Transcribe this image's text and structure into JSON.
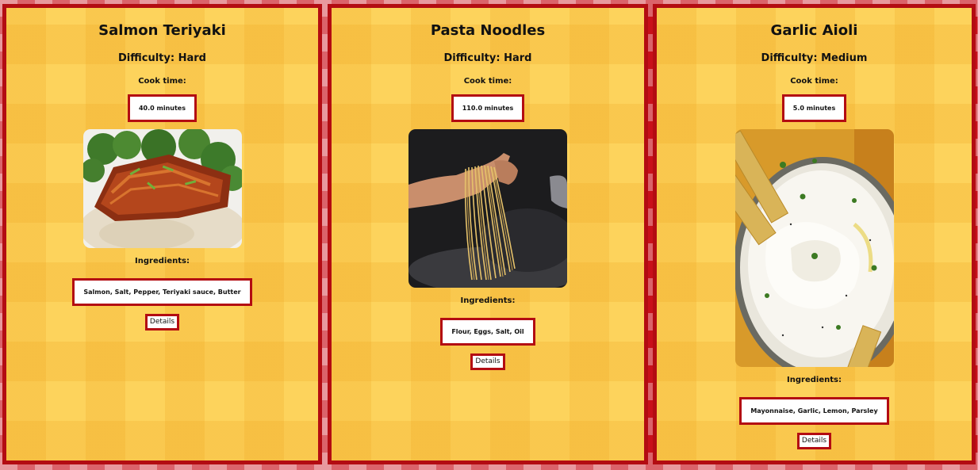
{
  "recipes": [
    {
      "title": "Salmon Teriyaki",
      "difficulty": "Difficulty: Hard",
      "cook_time_label": "Cook time:",
      "cook_time": "40.0 minutes",
      "ingredients_label": "Ingredients:",
      "ingredients": "Salmon, Salt, Pepper, Teriyaki sauce, Butter",
      "details_label": "Details"
    },
    {
      "title": "Pasta Noodles",
      "difficulty": "Difficulty: Hard",
      "cook_time_label": "Cook time:",
      "cook_time": "110.0 minutes",
      "ingredients_label": "Ingredients:",
      "ingredients": "Flour, Eggs, Salt, Oil",
      "details_label": "Details"
    },
    {
      "title": "Garlic Aioli",
      "difficulty": "Difficulty: Medium",
      "cook_time_label": "Cook time:",
      "cook_time": "5.0 minutes",
      "ingredients_label": "Ingredients:",
      "ingredients": "Mayonnaise, Garlic, Lemon, Parsley",
      "details_label": "Details"
    }
  ],
  "colors": {
    "page_background": "#c8101a",
    "card_background": "#fdd35c",
    "border": "#b30c12"
  }
}
